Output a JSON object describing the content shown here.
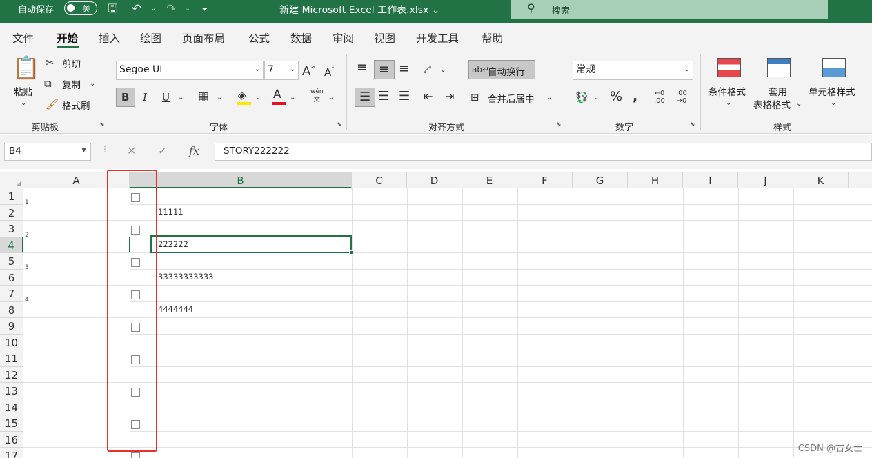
{
  "titlebar": {
    "autosave_label": "自动保存",
    "toggle_state": "关",
    "document_title": "新建 Microsoft Excel 工作表.xlsx",
    "search_placeholder": "搜索"
  },
  "tabs": [
    "文件",
    "开始",
    "插入",
    "绘图",
    "页面布局",
    "公式",
    "数据",
    "审阅",
    "视图",
    "开发工具",
    "帮助"
  ],
  "active_tab": "开始",
  "ribbon": {
    "clipboard": {
      "paste": "粘贴",
      "cut": "剪切",
      "copy": "复制",
      "format_painter": "格式刷",
      "group_label": "剪贴板"
    },
    "font": {
      "font_name": "Segoe UI",
      "font_size": "7",
      "group_label": "字体",
      "phonetic_hint": "wén"
    },
    "alignment": {
      "wrap_text": "自动换行",
      "merge_center": "合并后居中",
      "group_label": "对齐方式"
    },
    "number": {
      "format": "常规",
      "group_label": "数字"
    },
    "styles": {
      "conditional": "条件格式",
      "table_line1": "套用",
      "table_line2": "表格格式",
      "cell_styles": "单元格样式",
      "group_label": "样式"
    }
  },
  "formula_bar": {
    "name_box": "B4",
    "fx": "fx",
    "formula": "STORY222222"
  },
  "columns": [
    "A",
    "B",
    "C",
    "D",
    "E",
    "F",
    "G",
    "H",
    "I",
    "J",
    "K"
  ],
  "selected_column": "B",
  "rows": [
    "1",
    "2",
    "3",
    "4",
    "5",
    "6",
    "7",
    "8",
    "9",
    "10",
    "11",
    "12",
    "13",
    "14",
    "15",
    "16",
    "17"
  ],
  "selected_row": "4",
  "cells": {
    "A1": "1",
    "A3": "2",
    "A5": "3",
    "A7": "4",
    "B2": "11111",
    "B4": "222222",
    "B6": "33333333333",
    "B8": "4444444"
  },
  "checkboxes": [
    {
      "row": "1",
      "checked": false
    },
    {
      "row": "3",
      "checked": false
    },
    {
      "row": "5",
      "checked": false
    },
    {
      "row": "7",
      "checked": false
    },
    {
      "row": "9",
      "checked": false
    },
    {
      "row": "11",
      "checked": false
    },
    {
      "row": "13",
      "checked": false
    },
    {
      "row": "15",
      "checked": false
    },
    {
      "row": "17",
      "checked": false
    }
  ],
  "highlight_color": "#e8302b",
  "accent_color": "#217346",
  "watermark": "CSDN @古女士"
}
